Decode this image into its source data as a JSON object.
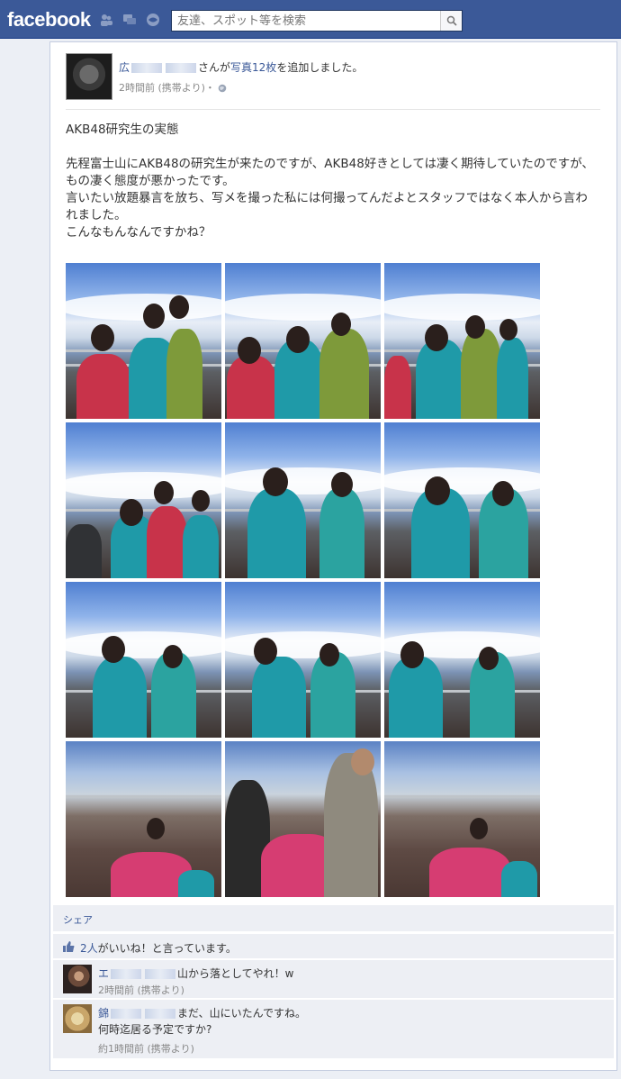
{
  "topbar": {
    "logo": "facebook",
    "search_placeholder": "友達、スポット等を検索",
    "bg_color": "#3b5998",
    "jewels": [
      "friends-icon",
      "messages-icon",
      "notifications-icon"
    ]
  },
  "post": {
    "author_name": "広",
    "author_action_prefix": "さんが",
    "photos_link": "写真12枚",
    "author_action_suffix": "を追加しました。",
    "timestamp": "2時間前 (携帯より)",
    "privacy_sep": "・",
    "title": "AKB48研究生の実態",
    "body_lines": [
      "先程富士山にAKB48の研究生が来たのですが、AKB48好きとしては凄く期待していたのですが、もの凄く態度が悪かったです。",
      "言いたい放題暴言を放ち、写メを撮った私には何撮ってんだよとスタッフではなく本人から言われました。",
      "こんなもんなんですかね？"
    ],
    "photo_count": 12
  },
  "actions": {
    "share": "シェア",
    "likes_count": "2人",
    "likes_suffix": "がいいね！と言っています。"
  },
  "comments": [
    {
      "author": "エ",
      "text": "山から落としてやれ！w",
      "time": "2時間前 (携帯より)"
    },
    {
      "author": "錦",
      "text_line1": "まだ、山にいたんですね。",
      "text_line2": "何時迄居る予定ですか?",
      "time": "約1時間前 (携帯より)"
    }
  ]
}
